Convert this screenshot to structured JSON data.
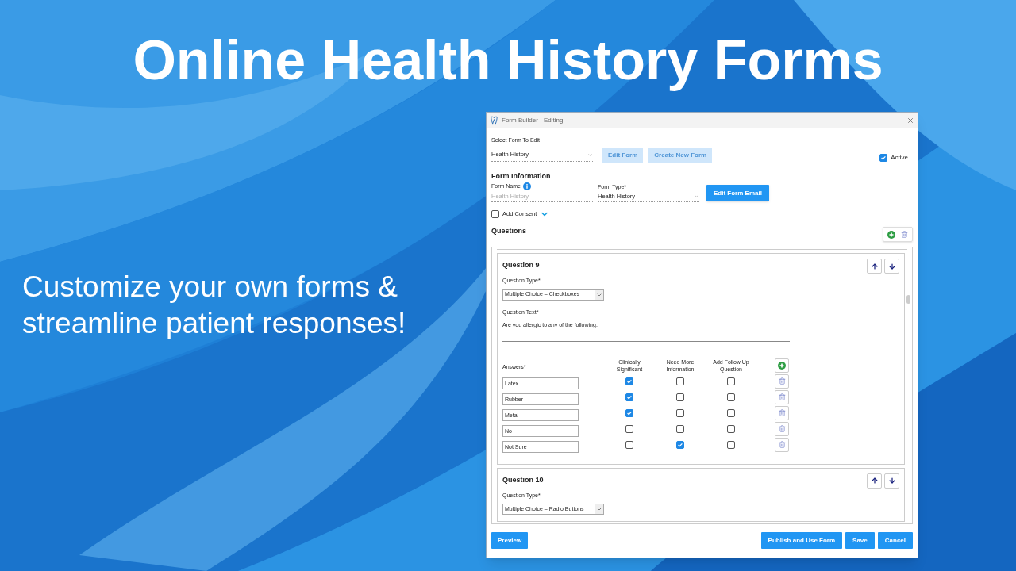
{
  "headline": "Online Health History Forms",
  "tagline": "Customize your own forms & streamline patient responses!",
  "window": {
    "title": "Form Builder - Editing"
  },
  "select_form": {
    "label": "Select Form To Edit",
    "value": "Health History"
  },
  "top_buttons": [
    {
      "label": "Edit Form",
      "disabled": true
    },
    {
      "label": "Create New Form",
      "disabled": true
    }
  ],
  "active": {
    "label": "Active",
    "checked": true
  },
  "form_information": {
    "heading": "Form Information",
    "form_name": {
      "label": "Form Name",
      "placeholder": "Health History"
    },
    "form_type": {
      "label": "Form Type*",
      "value": "Health History"
    },
    "email_button": "Edit Form Email"
  },
  "add_consent": {
    "label": "Add Consent",
    "checked": false
  },
  "questions": {
    "heading": "Questions",
    "items": [
      {
        "title": "Question 9",
        "type_label": "Question Type*",
        "type": "Multiple Choice – Checkboxes",
        "text_label": "Question Text*",
        "text": "Are you allergic to any of the following:",
        "answers_label": "Answers*",
        "columns": [
          "Clinically Significant",
          "Need More Information",
          "Add Follow Up Question"
        ],
        "answers": [
          {
            "value": "Latex",
            "clinically_significant": true,
            "need_more_information": false,
            "add_follow_up": false
          },
          {
            "value": "Rubber",
            "clinically_significant": true,
            "need_more_information": false,
            "add_follow_up": false
          },
          {
            "value": "Metal",
            "clinically_significant": true,
            "need_more_information": false,
            "add_follow_up": false
          },
          {
            "value": "No",
            "clinically_significant": false,
            "need_more_information": false,
            "add_follow_up": false
          },
          {
            "value": "Not Sure",
            "clinically_significant": false,
            "need_more_information": true,
            "add_follow_up": false
          }
        ]
      },
      {
        "title": "Question 10",
        "type_label": "Question Type*",
        "type": "Multiple Choice – Radio Buttons"
      }
    ]
  },
  "footer_left": [
    "Preview"
  ],
  "footer_right": [
    "Publish and Use Form",
    "Save",
    "Cancel"
  ]
}
